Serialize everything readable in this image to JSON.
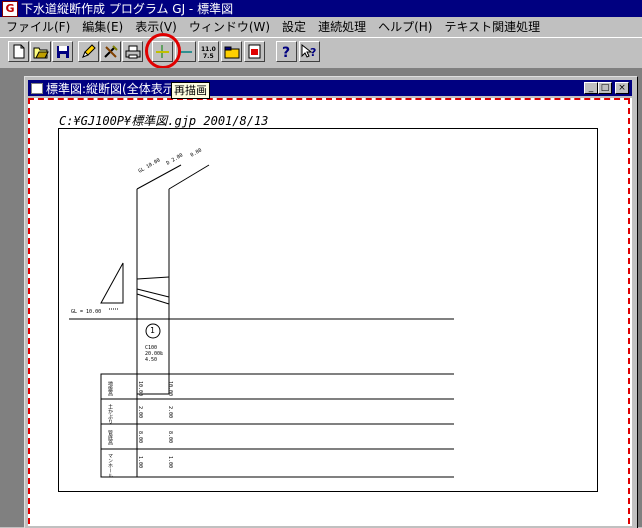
{
  "app": {
    "title": "下水道縦断作成 プログラム GJ - 標準図",
    "icon_glyph": "G"
  },
  "menu": {
    "items": [
      "ファイル(F)",
      "編集(E)",
      "表示(V)",
      "ウィンドウ(W)",
      "設定",
      "連続処理",
      "ヘルプ(H)",
      "テキスト関連処理"
    ]
  },
  "toolbar": {
    "buttons": [
      {
        "name": "new-file-icon"
      },
      {
        "name": "open-folder-icon"
      },
      {
        "name": "save-icon"
      },
      {
        "name": "pencil-icon"
      },
      {
        "name": "tools-icon"
      },
      {
        "name": "print-icon"
      },
      {
        "name": "redraw-icon"
      },
      {
        "name": "horizontal-line-icon"
      },
      {
        "name": "scale-icon",
        "text": "11.0\n7.5"
      },
      {
        "name": "folder-icon"
      },
      {
        "name": "dxf-icon"
      },
      {
        "name": "help-icon"
      },
      {
        "name": "context-help-icon"
      }
    ],
    "tooltip": "再描画",
    "highlight_color": "#e00000"
  },
  "child_window": {
    "title": "標準図:縦断図(全体表示)",
    "file_label": "C:¥GJ100P¥標準図.gjp 2001/8/13"
  },
  "drawing": {
    "gl_label": "GL = 10.00",
    "manhole_number": "1",
    "pipe_info_lines": [
      "C100",
      "20.00‰",
      "4.50"
    ],
    "top_labels": [
      "GL 10.00",
      "D 2.00",
      "0.80"
    ],
    "row_labels": [
      "地盤高",
      "土かぶり",
      "管底高",
      "マンホール"
    ],
    "row_values": [
      [
        "10.00",
        "10.00"
      ],
      [
        "2.00",
        "2.00"
      ],
      [
        "8.00",
        "8.00"
      ],
      [
        "1.00",
        "1.00"
      ]
    ]
  }
}
